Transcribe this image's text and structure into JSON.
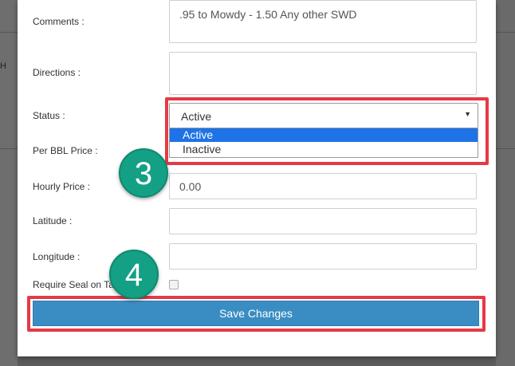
{
  "background": {
    "left_fragment": "H"
  },
  "form": {
    "comments": {
      "label": "Comments :",
      "value": ".95 to Mowdy - 1.50 Any other SWD"
    },
    "directions": {
      "label": "Directions :",
      "value": ""
    },
    "status": {
      "label": "Status :",
      "selected": "Active",
      "options": [
        "Active",
        "Inactive"
      ]
    },
    "per_bbl_price": {
      "label": "Per BBL Price :"
    },
    "hourly_price": {
      "label": "Hourly Price :",
      "value": "0.00"
    },
    "latitude": {
      "label": "Latitude :",
      "value": ""
    },
    "longitude": {
      "label": "Longitude :",
      "value": ""
    },
    "require_seal": {
      "label": "Require Seal on Ta",
      "checked": false
    },
    "save_button": "Save Changes"
  },
  "callouts": {
    "step_3": "3",
    "step_4": "4"
  },
  "colors": {
    "highlight": "#e53a45",
    "step_badge": "#14a085",
    "primary_button": "#3a8dc2",
    "selected_option": "#1e73e6"
  }
}
